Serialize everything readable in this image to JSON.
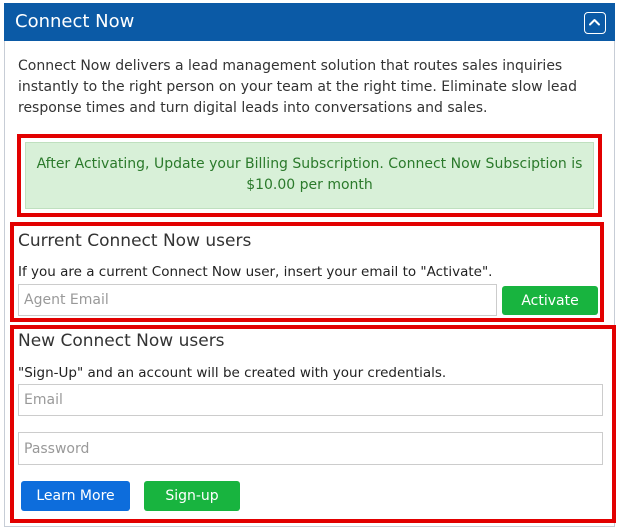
{
  "panel": {
    "title": "Connect Now",
    "description": "Connect Now delivers a lead management solution that routes sales inquiries instantly to the right person on your team at the right time. Eliminate slow lead response times and turn digital leads into conversations and sales."
  },
  "notice": {
    "text": "After Activating, Update your Billing Subscription. Connect Now Subsciption is $10.00 per month"
  },
  "current_users": {
    "heading": "Current Connect Now users",
    "instructions": "If you are a current Connect Now user, insert your email to \"Activate\".",
    "email_placeholder": "Agent Email",
    "activate_label": "Activate"
  },
  "new_users": {
    "heading": "New Connect Now users",
    "instructions": "\"Sign-Up\" and an account will be created with your credentials.",
    "email_placeholder": "Email",
    "password_placeholder": "Password",
    "learn_more_label": "Learn More",
    "signup_label": "Sign-up"
  },
  "icons": {
    "collapse": "chevron-up-icon"
  },
  "colors": {
    "header": "#0b5aa6",
    "highlight_border": "#e20000",
    "notice_bg": "#d8f0d8",
    "notice_text": "#2b7a2b",
    "green_button": "#18b43f",
    "blue_button": "#0d6ddc"
  }
}
